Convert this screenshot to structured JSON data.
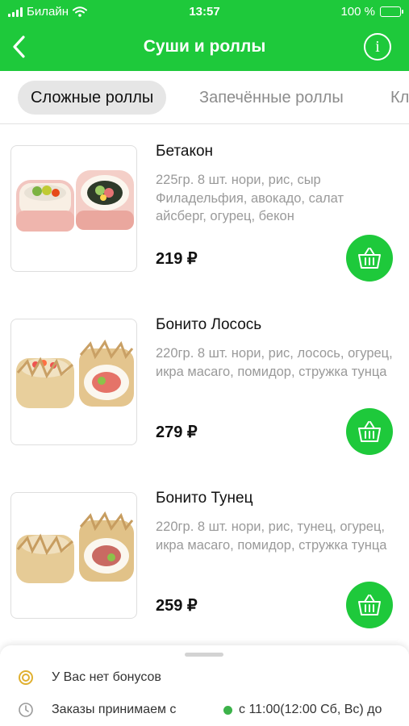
{
  "status_bar": {
    "carrier": "Билайн",
    "time": "13:57",
    "battery": "100 %"
  },
  "header": {
    "title": "Суши и роллы"
  },
  "tabs": [
    {
      "label": "Сложные роллы",
      "active": true
    },
    {
      "label": "Запечённые роллы",
      "active": false
    },
    {
      "label": "Кл",
      "active": false
    }
  ],
  "products": [
    {
      "name": "Бетакон",
      "description": "225гр. 8 шт. нори, рис, сыр Филадельфия, авокадо, салат айсберг, огурец, бекон",
      "price": "219 ₽"
    },
    {
      "name": "Бонито Лосось",
      "description": "220гр. 8 шт. нори, рис, лосось, огурец, икра масаго, помидор, стружка тунца",
      "price": "279 ₽"
    },
    {
      "name": "Бонито Тунец",
      "description": "220гр. 8 шт. нори, рис, тунец, огурец, икра масаго, помидор, стружка тунца",
      "price": "259 ₽"
    }
  ],
  "bottom_sheet": {
    "bonus_text": "У Вас нет бонусов",
    "orders_text": "Заказы принимаем с",
    "hours_text": "с 11:00(12:00 Сб, Вс) до"
  },
  "colors": {
    "accent": "#1ec93b",
    "open_dot": "#3cb24a"
  },
  "icons": {
    "back": "chevron-left-icon",
    "info": "info-icon",
    "cart": "basket-icon",
    "bonus": "coin-icon",
    "clock": "clock-icon"
  }
}
